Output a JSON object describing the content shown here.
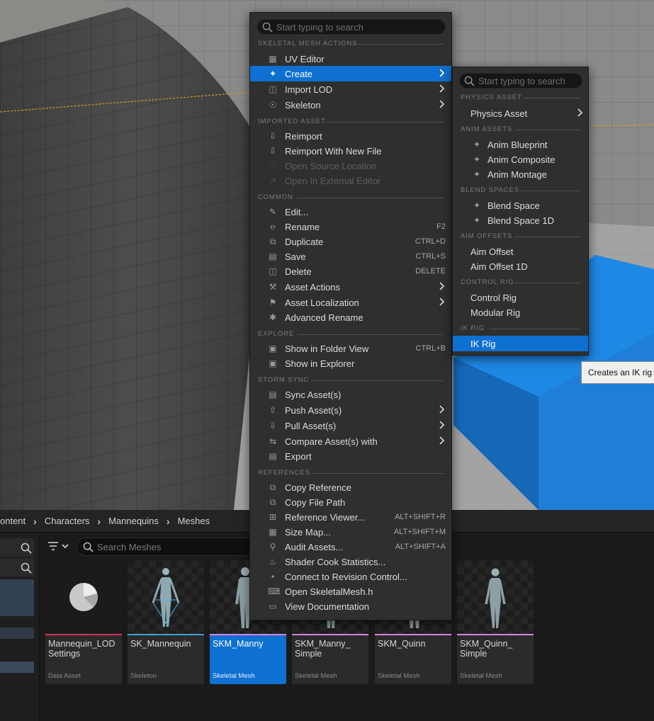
{
  "main_menu": {
    "search_placeholder": "Start typing to search",
    "sections": {
      "skeletal_mesh_actions": "SKELETAL MESH ACTIONS",
      "imported_asset": "IMPORTED ASSET",
      "common": "COMMON",
      "explore": "EXPLORE",
      "storm_sync": "STORM SYNC",
      "references": "REFERENCES"
    },
    "items": {
      "uv_editor": "UV Editor",
      "create": "Create",
      "import_lod": "Import LOD",
      "skeleton": "Skeleton",
      "reimport": "Reimport",
      "reimport_new": "Reimport With New File",
      "open_source": "Open Source Location",
      "open_external": "Open In External Editor",
      "edit": "Edit...",
      "rename": "Rename",
      "duplicate": "Duplicate",
      "save": "Save",
      "delete": "Delete",
      "asset_actions": "Asset Actions",
      "asset_localization": "Asset Localization",
      "advanced_rename": "Advanced Rename",
      "show_folder": "Show in Folder View",
      "show_explorer": "Show in Explorer",
      "sync_assets": "Sync Asset(s)",
      "push_assets": "Push Asset(s)",
      "pull_assets": "Pull Asset(s)",
      "compare_assets": "Compare Asset(s) with",
      "export": "Export",
      "copy_reference": "Copy Reference",
      "copy_file_path": "Copy File Path",
      "reference_viewer": "Reference Viewer...",
      "size_map": "Size Map...",
      "audit_assets": "Audit Assets...",
      "shader_cook": "Shader Cook Statistics...",
      "connect_rc": "Connect to Revision Control...",
      "open_header": "Open SkeletalMesh.h",
      "view_docs": "View Documentation"
    },
    "shortcuts": {
      "rename": "F2",
      "duplicate": "CTRL+D",
      "save": "CTRL+S",
      "delete": "DELETE",
      "show_folder": "CTRL+B",
      "reference_viewer": "ALT+SHIFT+R",
      "size_map": "ALT+SHIFT+M",
      "audit_assets": "ALT+SHIFT+A"
    }
  },
  "sub_menu": {
    "search_placeholder": "Start typing to search",
    "sections": {
      "physics_asset": "PHYSICS ASSET",
      "anim_assets": "ANIM ASSETS",
      "blend_spaces": "BLEND SPACES",
      "aim_offsets": "AIM OFFSETS",
      "control_rig": "CONTROL RIG",
      "ik_rig": "IK RIG"
    },
    "items": {
      "physics_asset": "Physics Asset",
      "anim_blueprint": "Anim Blueprint",
      "anim_composite": "Anim Composite",
      "anim_montage": "Anim Montage",
      "blend_space": "Blend Space",
      "blend_space_1d": "Blend Space 1D",
      "aim_offset": "Aim Offset",
      "aim_offset_1d": "Aim Offset 1D",
      "control_rig": "Control Rig",
      "modular_rig": "Modular Rig",
      "ik_rig": "IK Rig"
    }
  },
  "tooltip": {
    "text": "Creates an IK rig t"
  },
  "breadcrumb": [
    "ontent",
    "Characters",
    "Mannequins",
    "Meshes"
  ],
  "search_meshes": {
    "placeholder": "Search Meshes"
  },
  "assets": [
    {
      "name": "Mannequin_LOD Settings",
      "type": "Data Asset",
      "color": "#d6315d"
    },
    {
      "name": "SK_Mannequin",
      "type": "Skeleton",
      "color": "#3aa1d6"
    },
    {
      "name": "SKM_Manny",
      "type": "Skeletal Mesh",
      "color": "#d884e0"
    },
    {
      "name": "SKM_Manny_ Simple",
      "type": "Skeletal Mesh",
      "color": "#d884e0"
    },
    {
      "name": "SKM_Quinn",
      "type": "Skeletal Mesh",
      "color": "#d884e0"
    },
    {
      "name": "SKM_Quinn_ Simple",
      "type": "Skeletal Mesh",
      "color": "#d884e0"
    }
  ],
  "colors": {
    "highlight": "#0e70d1",
    "menu_bg": "#2f2f2f",
    "cube": "#1e88e5"
  }
}
